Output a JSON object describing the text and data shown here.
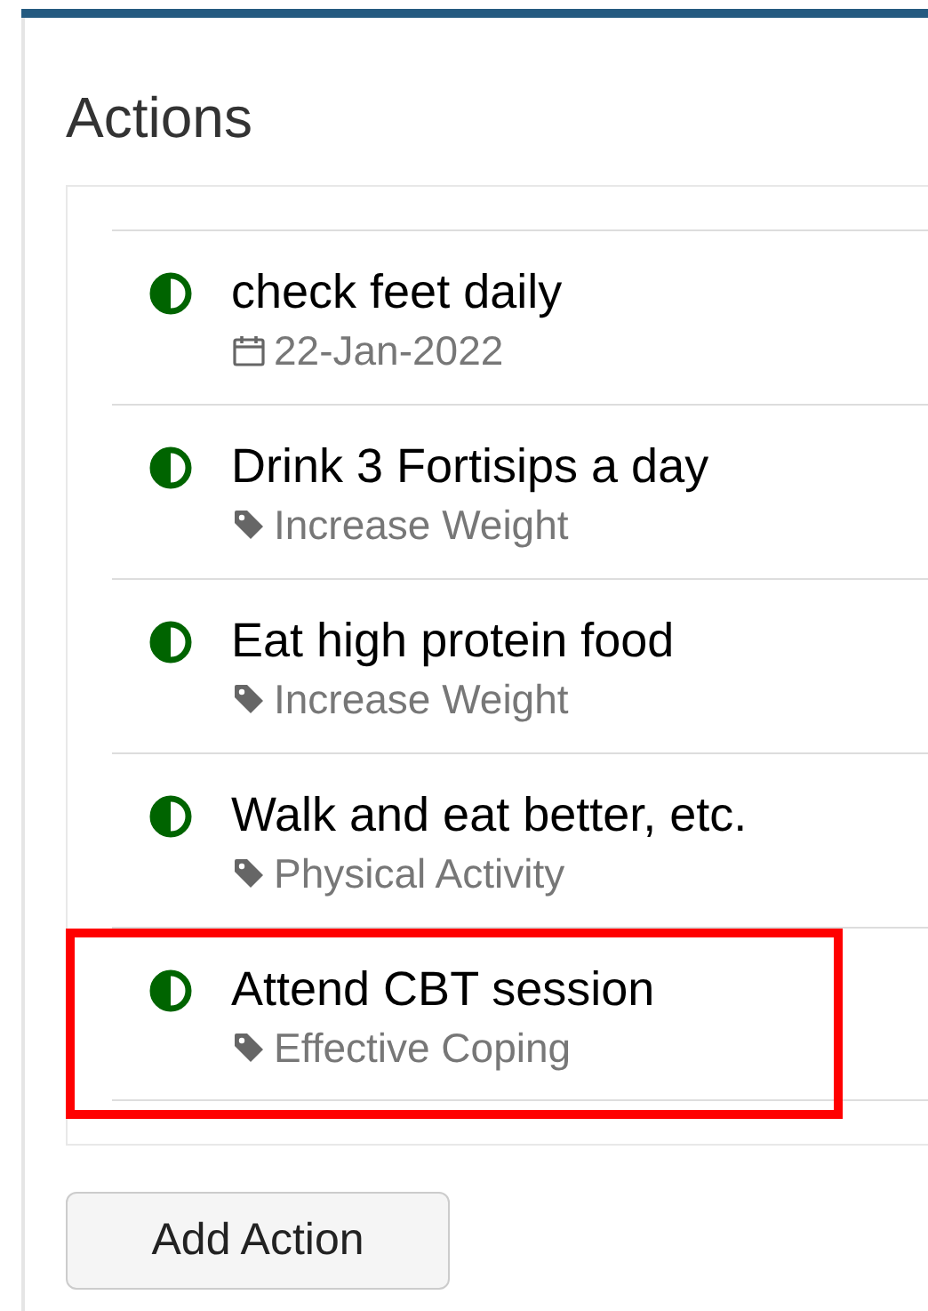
{
  "title": "Actions",
  "actions": [
    {
      "title": "check feet daily",
      "kind": "date",
      "meta": "22-Jan-2022",
      "highlighted": false
    },
    {
      "title": "Drink 3 Fortisips a day",
      "kind": "tag",
      "meta": "Increase Weight",
      "highlighted": false
    },
    {
      "title": "Eat high protein food",
      "kind": "tag",
      "meta": "Increase Weight",
      "highlighted": false
    },
    {
      "title": "Walk and eat better, etc.",
      "kind": "tag",
      "meta": "Physical Activity",
      "highlighted": false
    },
    {
      "title": "Attend CBT session",
      "kind": "tag",
      "meta": "Effective Coping",
      "highlighted": true
    }
  ],
  "button": "Add Action"
}
